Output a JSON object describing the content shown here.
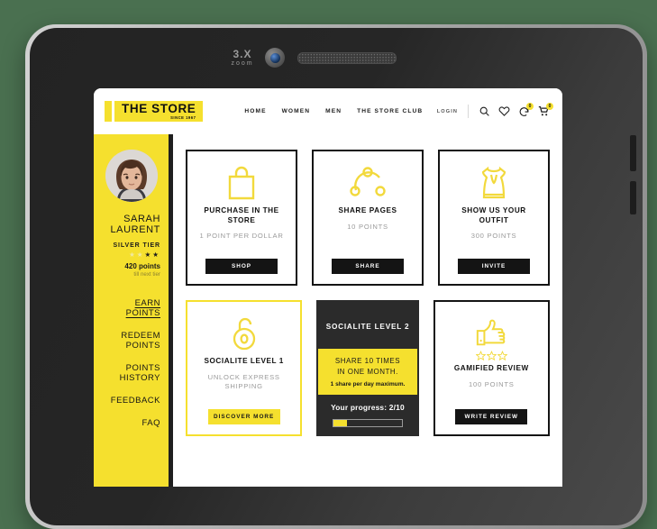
{
  "device": {
    "camera_label_big": "3.X",
    "camera_label_small": "zoom",
    "camera_icon": "camera-lens-icon",
    "speaker_icon": "speaker-grille-icon"
  },
  "header": {
    "logo": {
      "name": "THE STORE",
      "tagline": "SINCE 1967"
    },
    "nav": [
      {
        "label": "HOME"
      },
      {
        "label": "WOMEN"
      },
      {
        "label": "MEN"
      },
      {
        "label": "THE STORE CLUB"
      }
    ],
    "login_label": "LOGIN",
    "icons": [
      {
        "name": "search-icon"
      },
      {
        "name": "heart-icon"
      },
      {
        "name": "notification-bell-icon",
        "badge": "0"
      },
      {
        "name": "shopping-cart-icon",
        "badge": "0"
      }
    ]
  },
  "sidebar": {
    "avatar_icon": "user-avatar-photo",
    "user_name_line1": "SARAH",
    "user_name_line2": "LAURENT",
    "tier": "SILVER TIER",
    "stars_total": 4,
    "stars_filled": 2,
    "points": "420 points",
    "points_sub": "till next tier",
    "menu": [
      {
        "label": "EARN POINTS",
        "active": true
      },
      {
        "label": "REDEEM POINTS",
        "active": false
      },
      {
        "label": "POINTS HISTORY",
        "active": false
      },
      {
        "label": "FEEDBACK",
        "active": false
      },
      {
        "label": "FAQ",
        "active": false
      }
    ]
  },
  "cards": {
    "purchase": {
      "icon": "shopping-bag-icon",
      "title": "PURCHASE IN THE STORE",
      "subtitle": "1 POINT PER DOLLAR",
      "button": "SHOP"
    },
    "share": {
      "icon": "share-network-icon",
      "title": "SHARE PAGES",
      "subtitle": "10 POINTS",
      "button": "SHARE"
    },
    "outfit": {
      "icon": "dress-icon",
      "title": "SHOW US YOUR OUTFIT",
      "subtitle": "300 POINTS",
      "button": "INVITE"
    },
    "socialite1": {
      "icon": "unlocked-padlock-icon",
      "title": "SOCIALITE LEVEL 1",
      "subtitle": "UNLOCK EXPRESS SHIPPING",
      "button": "DISCOVER MORE"
    },
    "socialite2": {
      "title": "SOCIALITE LEVEL 2",
      "challenge_line1": "SHARE 10 TIMES",
      "challenge_line2": "IN ONE MONTH.",
      "challenge_note": "1 share per day maximum.",
      "progress_label": "Your progress: 2/10",
      "progress_percent": 20
    },
    "review": {
      "icon": "thumbs-up-icon",
      "stars": 3,
      "title": "GAMIFIED REVIEW",
      "subtitle": "100 POINTS",
      "button": "WRITE REVIEW"
    }
  },
  "colors": {
    "brand_yellow": "#f5e02e",
    "ink": "#141414",
    "muted": "#9a9a9a",
    "dark_card": "#2b2b2b",
    "backdrop_green": "#4a7050"
  }
}
